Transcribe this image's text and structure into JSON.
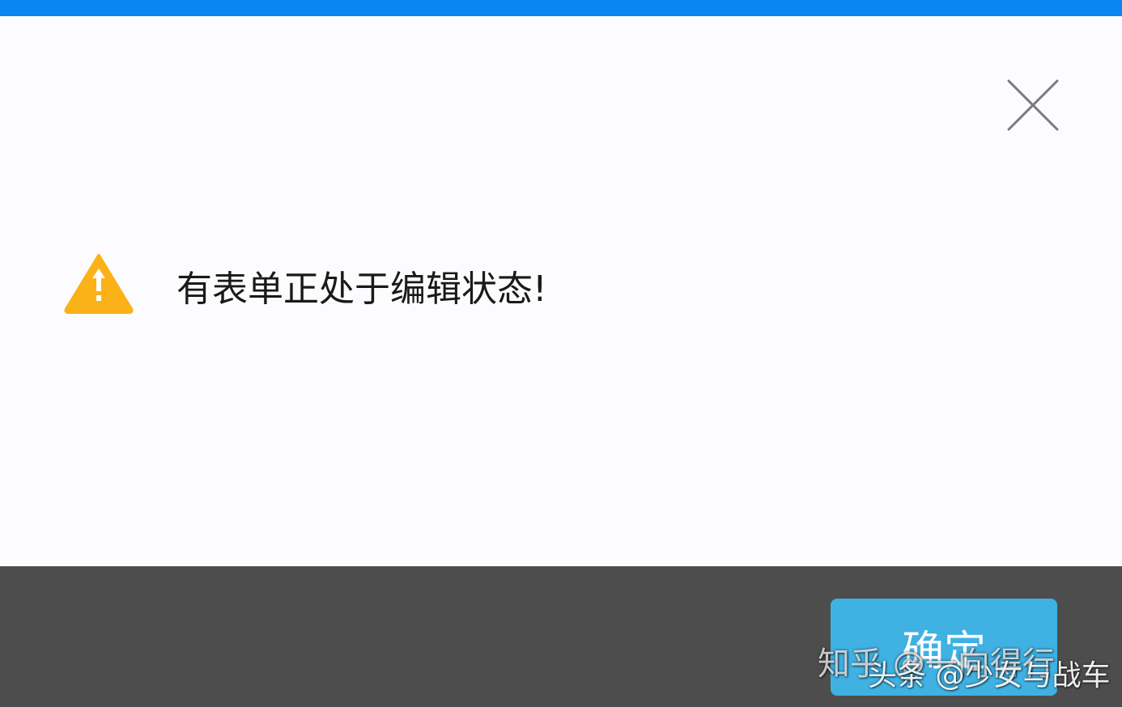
{
  "dialog": {
    "message": "有表单正处于编辑状态!",
    "ok_label": "确定",
    "icons": {
      "close": "close-icon",
      "warning": "warning-icon"
    }
  },
  "watermarks": {
    "zhihu": "知乎 @一向得行",
    "toutiao": "头条 @少女与战车"
  },
  "colors": {
    "title_bar": "#0a86f0",
    "dialog_bg": "#fcfbfd",
    "footer_bg": "#4d4d4d",
    "ok_button": "#3fb1e3",
    "warning": "#fbb217"
  }
}
